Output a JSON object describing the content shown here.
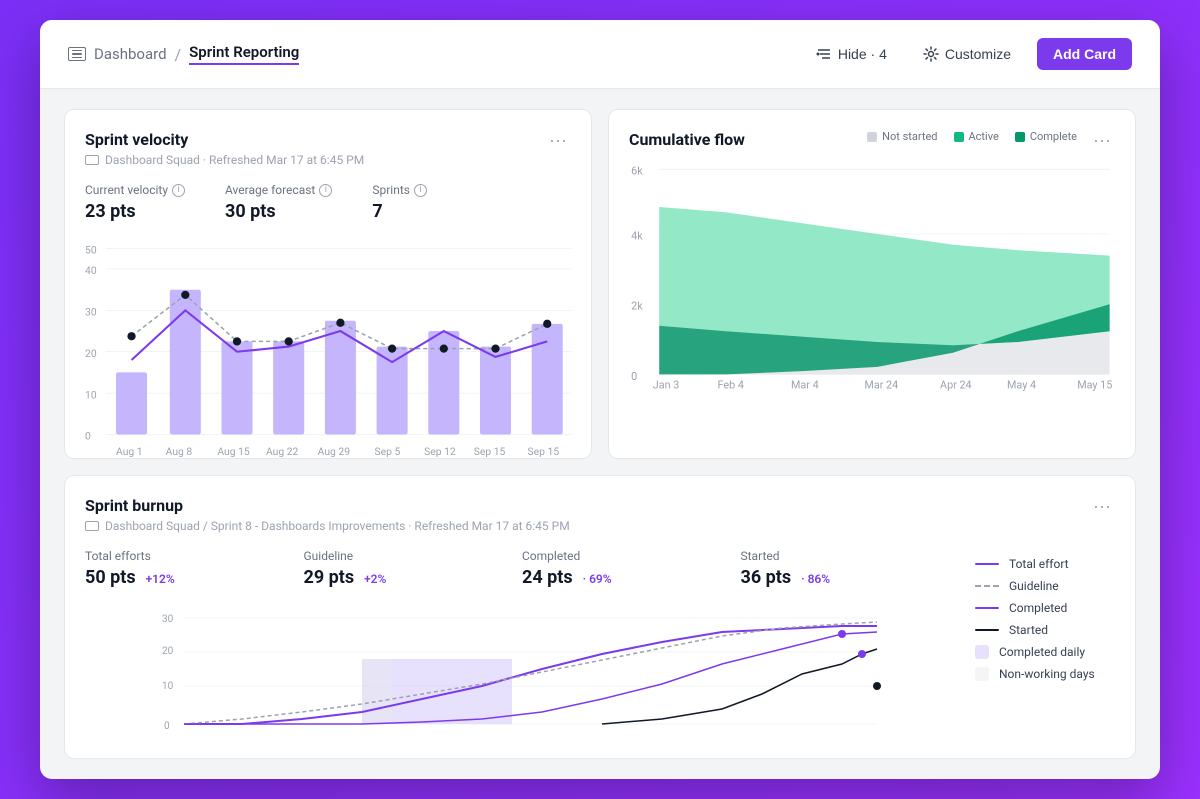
{
  "header": {
    "dashboard_label": "Dashboard",
    "page_title": "Sprint Reporting",
    "hide_label": "Hide · 4",
    "customize_label": "Customize",
    "add_card_label": "Add Card"
  },
  "velocity_card": {
    "title": "Sprint velocity",
    "subtitle": "Dashboard Squad · Refreshed Mar 17 at 6:45 PM",
    "metrics": [
      {
        "label": "Current velocity",
        "value": "23 pts"
      },
      {
        "label": "Average forecast",
        "value": "30 pts"
      },
      {
        "label": "Sprints",
        "value": "7"
      }
    ]
  },
  "cumulative_card": {
    "title": "Cumulative flow",
    "legend": [
      {
        "label": "Not started",
        "color": "#d1d5db"
      },
      {
        "label": "Active",
        "color": "#10b981"
      },
      {
        "label": "Complete",
        "color": "#059669"
      }
    ],
    "x_labels": [
      "Jan 3",
      "Feb 4",
      "Mar 4",
      "Mar 24",
      "Apr 24",
      "May 4",
      "May 15"
    ],
    "y_labels": [
      "0",
      "2k",
      "4k",
      "6k"
    ]
  },
  "burnup_card": {
    "title": "Sprint burnup",
    "subtitle": "Dashboard Squad / Sprint 8 - Dashboards Improvements · Refreshed Mar 17 at 6:45 PM",
    "stats": [
      {
        "label": "Total efforts",
        "value": "50 pts",
        "change": "+12%"
      },
      {
        "label": "Guideline",
        "value": "29 pts",
        "change": "+2%"
      },
      {
        "label": "Completed",
        "value": "24 pts",
        "change": "69%",
        "is_pct": true
      },
      {
        "label": "Started",
        "value": "36 pts",
        "change": "86%",
        "is_pct": true
      }
    ],
    "legend": [
      {
        "label": "Total effort",
        "type": "solid",
        "color": "#7c3aed"
      },
      {
        "label": "Guideline",
        "type": "dashed",
        "color": "#9ca3af"
      },
      {
        "label": "Completed",
        "type": "solid",
        "color": "#7c3aed"
      },
      {
        "label": "Started",
        "type": "solid",
        "color": "#111827"
      },
      {
        "label": "Completed daily",
        "type": "box",
        "color": "#c4b5fd"
      },
      {
        "label": "Non-working days",
        "type": "box",
        "color": "#e5e7eb"
      }
    ]
  }
}
